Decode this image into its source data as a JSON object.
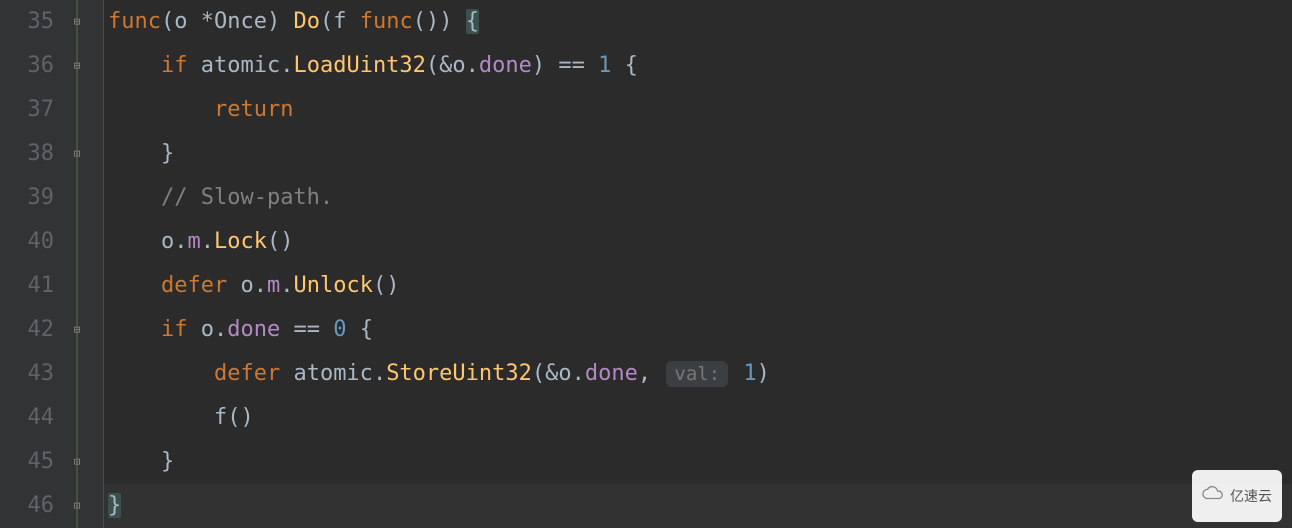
{
  "gutter": {
    "lines": [
      "35",
      "36",
      "37",
      "38",
      "39",
      "40",
      "41",
      "42",
      "43",
      "44",
      "45",
      "46"
    ]
  },
  "code": {
    "l35": {
      "kw_func": "func",
      "paren_o": "(",
      "recv_id": "o ",
      "star": "*",
      "recv_ty": "Once",
      "paren_c": ") ",
      "fn": "Do",
      "sig_o": "(",
      "p_id": "f ",
      "kw_func2": "func",
      "sig_unit": "()",
      "sig_c": ") ",
      "brace": "{"
    },
    "l36": {
      "indent": "    ",
      "kw_if": "if ",
      "pkg": "atomic",
      "dot": ".",
      "call": "LoadUint32",
      "args_o": "(",
      "amp": "&",
      "obj": "o",
      "dot2": ".",
      "field": "done",
      "args_c": ") ",
      "eq": "==",
      "sp": " ",
      "num": "1",
      "sp2": " ",
      "brace": "{"
    },
    "l37": {
      "indent": "        ",
      "kw": "return"
    },
    "l38": {
      "indent": "    ",
      "brace": "}"
    },
    "l39": {
      "indent": "    ",
      "cmt": "// Slow-path."
    },
    "l40": {
      "indent": "    ",
      "o": "o",
      "d1": ".",
      "m": "m",
      "d2": ".",
      "fn": "Lock",
      "unit": "()"
    },
    "l41": {
      "indent": "    ",
      "kw": "defer ",
      "o": "o",
      "d1": ".",
      "m": "m",
      "d2": ".",
      "fn": "Unlock",
      "unit": "()"
    },
    "l42": {
      "indent": "    ",
      "kw": "if ",
      "o": "o",
      "d": ".",
      "f": "done ",
      "eq": "==",
      "sp": " ",
      "num": "0",
      "sp2": " ",
      "brace": "{"
    },
    "l43": {
      "indent": "        ",
      "kw": "defer ",
      "pkg": "atomic",
      "d": ".",
      "fn": "StoreUint32",
      "o": "(",
      "amp": "&",
      "obj": "o",
      "d2": ".",
      "field": "done",
      "comma": ", ",
      "hint": "val:",
      "sp": " ",
      "num": "1",
      "c": ")"
    },
    "l44": {
      "indent": "        ",
      "f": "f",
      "unit": "()"
    },
    "l45": {
      "indent": "    ",
      "brace": "}"
    },
    "l46": {
      "brace": "}"
    }
  },
  "watermark": {
    "text": "亿速云"
  }
}
